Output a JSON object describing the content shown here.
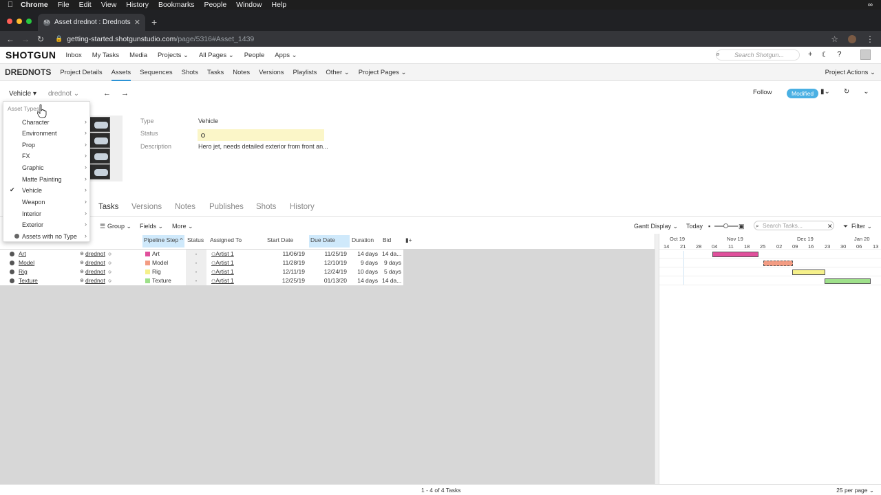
{
  "menubar": {
    "apple": "",
    "items": [
      "Chrome",
      "File",
      "Edit",
      "View",
      "History",
      "Bookmarks",
      "People",
      "Window",
      "Help"
    ],
    "right_icon": "∞"
  },
  "browser": {
    "tab_title": "Asset drednot : Drednots",
    "favicon": "SG",
    "url_host": "getting-started.shotgunstudio.com",
    "url_path": "/page/5316#Asset_1439"
  },
  "topnav": {
    "logo": "SHOTGUN",
    "items": [
      "Inbox",
      "My Tasks",
      "Media",
      "Projects ⌄",
      "All Pages ⌄",
      "People",
      "Apps ⌄"
    ],
    "search_placeholder": "Search Shotgun..."
  },
  "projnav": {
    "project": "DREDNOTS",
    "items": [
      "Project Details",
      "Assets",
      "Sequences",
      "Shots",
      "Tasks",
      "Notes",
      "Versions",
      "Playlists",
      "Other ⌄",
      "Project Pages ⌄"
    ],
    "active": "Assets",
    "actions": "Project Actions ⌄"
  },
  "header": {
    "crumb_type": "Vehicle  ▾",
    "crumb_name": "drednot ⌄",
    "arrows": "← →",
    "follow": "Follow",
    "status_badge": "Modified"
  },
  "fields": {
    "type_label": "Type",
    "type_value": "Vehicle",
    "status_label": "Status",
    "desc_label": "Description",
    "desc_value": "Hero jet, needs detailed exterior from front an..."
  },
  "subtabs": [
    "Tasks",
    "Versions",
    "Notes",
    "Publishes",
    "Shots",
    "History"
  ],
  "toolbar": {
    "group": "Group ⌄",
    "fields": "Fields ⌄",
    "more": "More ⌄",
    "gantt": "Gantt Display ⌄",
    "today": "Today",
    "search_placeholder": "Search Tasks...",
    "filter": "Filter ⌄"
  },
  "grid": {
    "headers": [
      "Pipeline Step ^",
      "Status",
      "Assigned To",
      "Start Date",
      "Due Date",
      "Duration",
      "Bid"
    ],
    "rows": [
      {
        "name": "Art",
        "link": "drednot",
        "step": "Art",
        "color": "#e0509c",
        "status": "-",
        "assigned": "Artist 1",
        "start": "11/06/19",
        "due": "11/25/19",
        "duration": "14 days",
        "bid": "14 da..."
      },
      {
        "name": "Model",
        "link": "drednot",
        "step": "Model",
        "color": "#f39c83",
        "status": "-",
        "assigned": "Artist 1",
        "start": "11/28/19",
        "due": "12/10/19",
        "duration": "9 days",
        "bid": "9 days"
      },
      {
        "name": "Rig",
        "link": "drednot",
        "step": "Rig",
        "color": "#f5f08a",
        "status": "-",
        "assigned": "Artist 1",
        "start": "12/11/19",
        "due": "12/24/19",
        "duration": "10 days",
        "bid": "5 days"
      },
      {
        "name": "Texture",
        "link": "drednot",
        "step": "Texture",
        "color": "#9ee08a",
        "status": "-",
        "assigned": "Artist 1",
        "start": "12/25/19",
        "due": "01/13/20",
        "duration": "14 days",
        "bid": "14 da..."
      }
    ]
  },
  "gantt": {
    "months": [
      "Oct 19",
      "Nov 19",
      "Dec 19",
      "Jan 20"
    ],
    "days": [
      "14",
      "21",
      "28",
      "04",
      "11",
      "18",
      "25",
      "02",
      "09",
      "16",
      "23",
      "30",
      "06",
      "13"
    ]
  },
  "footer": {
    "count": "1 - 4 of 4 Tasks",
    "per_page": "25 per page ⌄"
  },
  "menu": {
    "header": "Asset Types",
    "items": [
      "Character",
      "Environment",
      "Prop",
      "FX",
      "Graphic",
      "Matte Painting",
      "Vehicle",
      "Weapon",
      "Interior",
      "Exterior",
      "Assets with no Type"
    ],
    "checked": "Vehicle"
  }
}
